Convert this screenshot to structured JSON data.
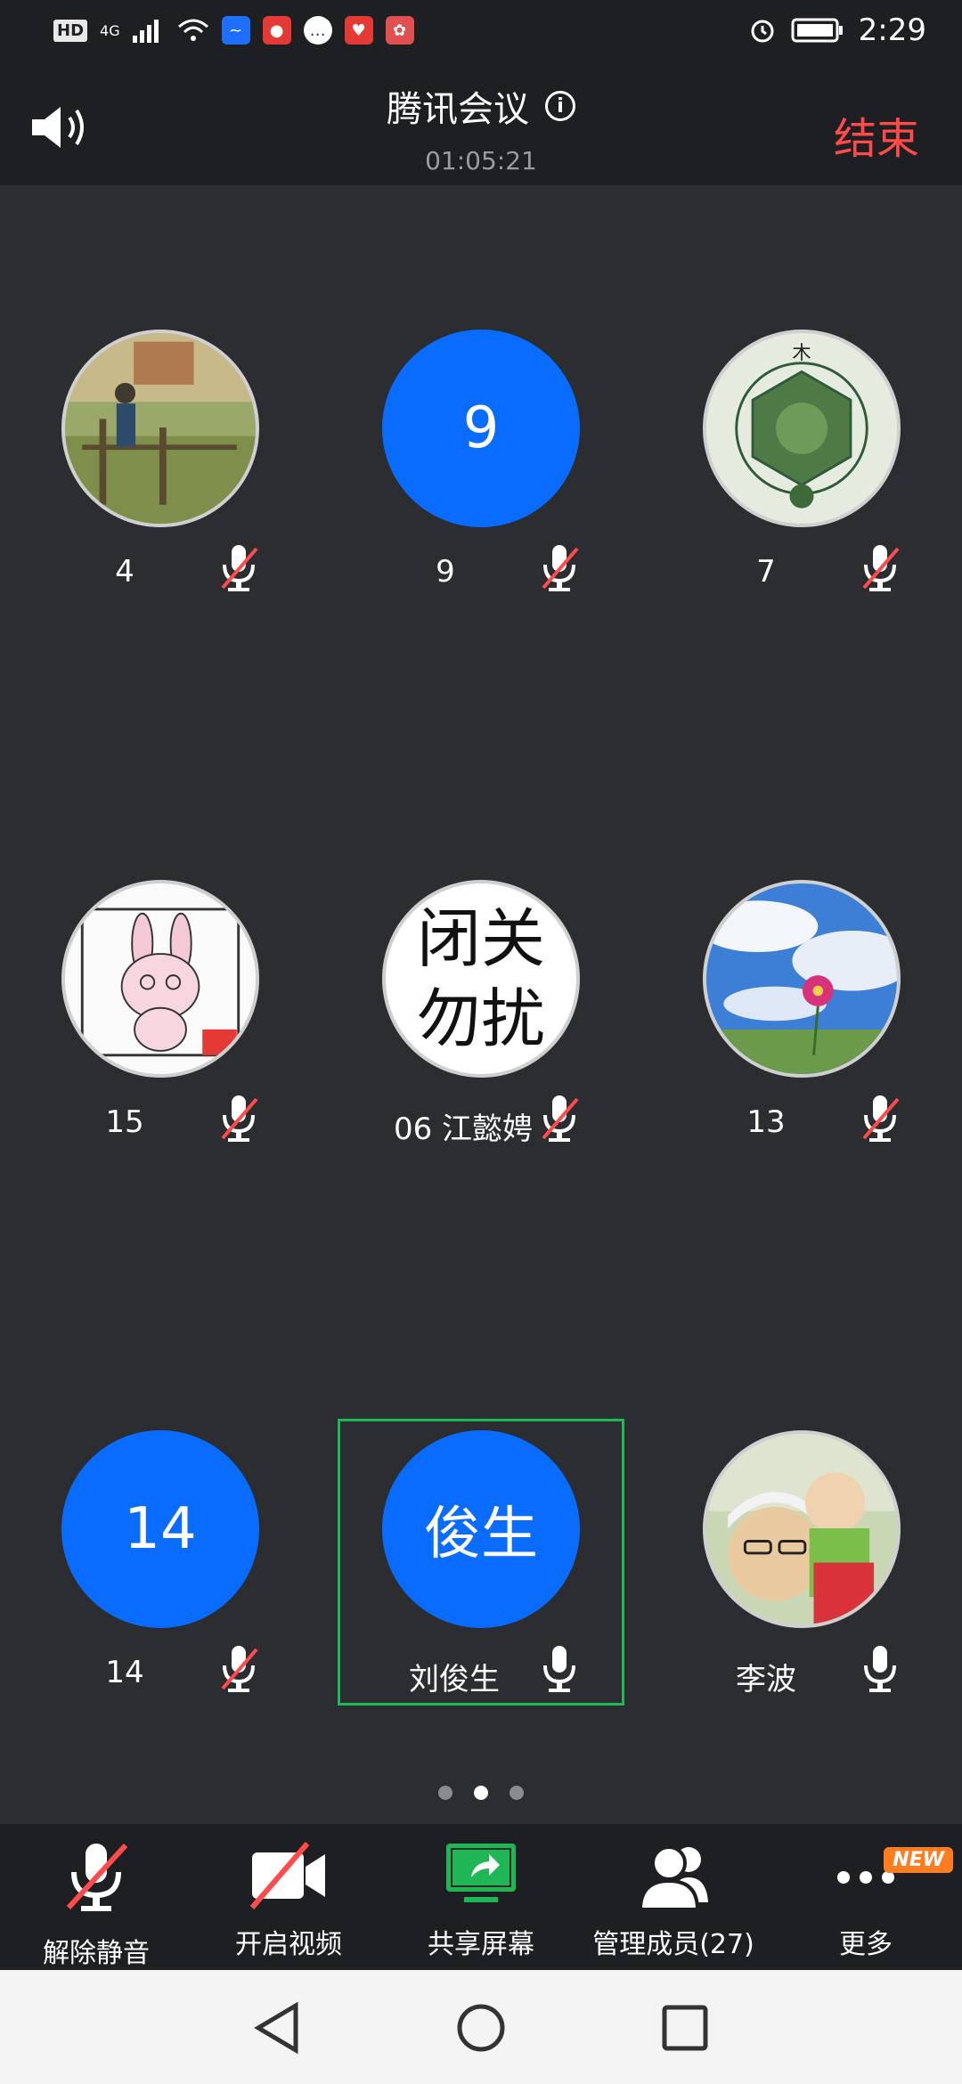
{
  "status_bar": {
    "network": "4G",
    "hd": "HD",
    "time": "2:29"
  },
  "header": {
    "title": "腾讯会议",
    "timer": "01:05:21",
    "end_label": "结束"
  },
  "participants": [
    {
      "name": "4",
      "avatar_text": "",
      "avatar_kind": "photo",
      "muted": true
    },
    {
      "name": "9",
      "avatar_text": "9",
      "avatar_kind": "blue",
      "muted": true
    },
    {
      "name": "7",
      "avatar_text": "",
      "avatar_kind": "photo",
      "muted": true
    },
    {
      "name": "15",
      "avatar_text": "",
      "avatar_kind": "photo",
      "muted": true
    },
    {
      "name": "06 江懿娉",
      "avatar_text": "闭关 勿扰",
      "avatar_kind": "text",
      "muted": true
    },
    {
      "name": "13",
      "avatar_text": "",
      "avatar_kind": "photo",
      "muted": true
    },
    {
      "name": "14",
      "avatar_text": "14",
      "avatar_kind": "blue",
      "muted": true
    },
    {
      "name": "刘俊生",
      "avatar_text": "俊生",
      "avatar_kind": "blue",
      "muted": false
    },
    {
      "name": "李波",
      "avatar_text": "",
      "avatar_kind": "photo",
      "muted": false
    }
  ],
  "pager": {
    "pages": 3,
    "current": 2
  },
  "toolbar": {
    "unmute": "解除静音",
    "start_video": "开启视频",
    "share_screen": "共享屏幕",
    "manage_members": "管理成员(27)",
    "more": "更多",
    "new_badge": "NEW"
  },
  "colors": {
    "accent_blue": "#0a6cff",
    "end_red": "#ff4b4b",
    "share_green": "#1fb655",
    "new_orange": "#ff7d20"
  }
}
